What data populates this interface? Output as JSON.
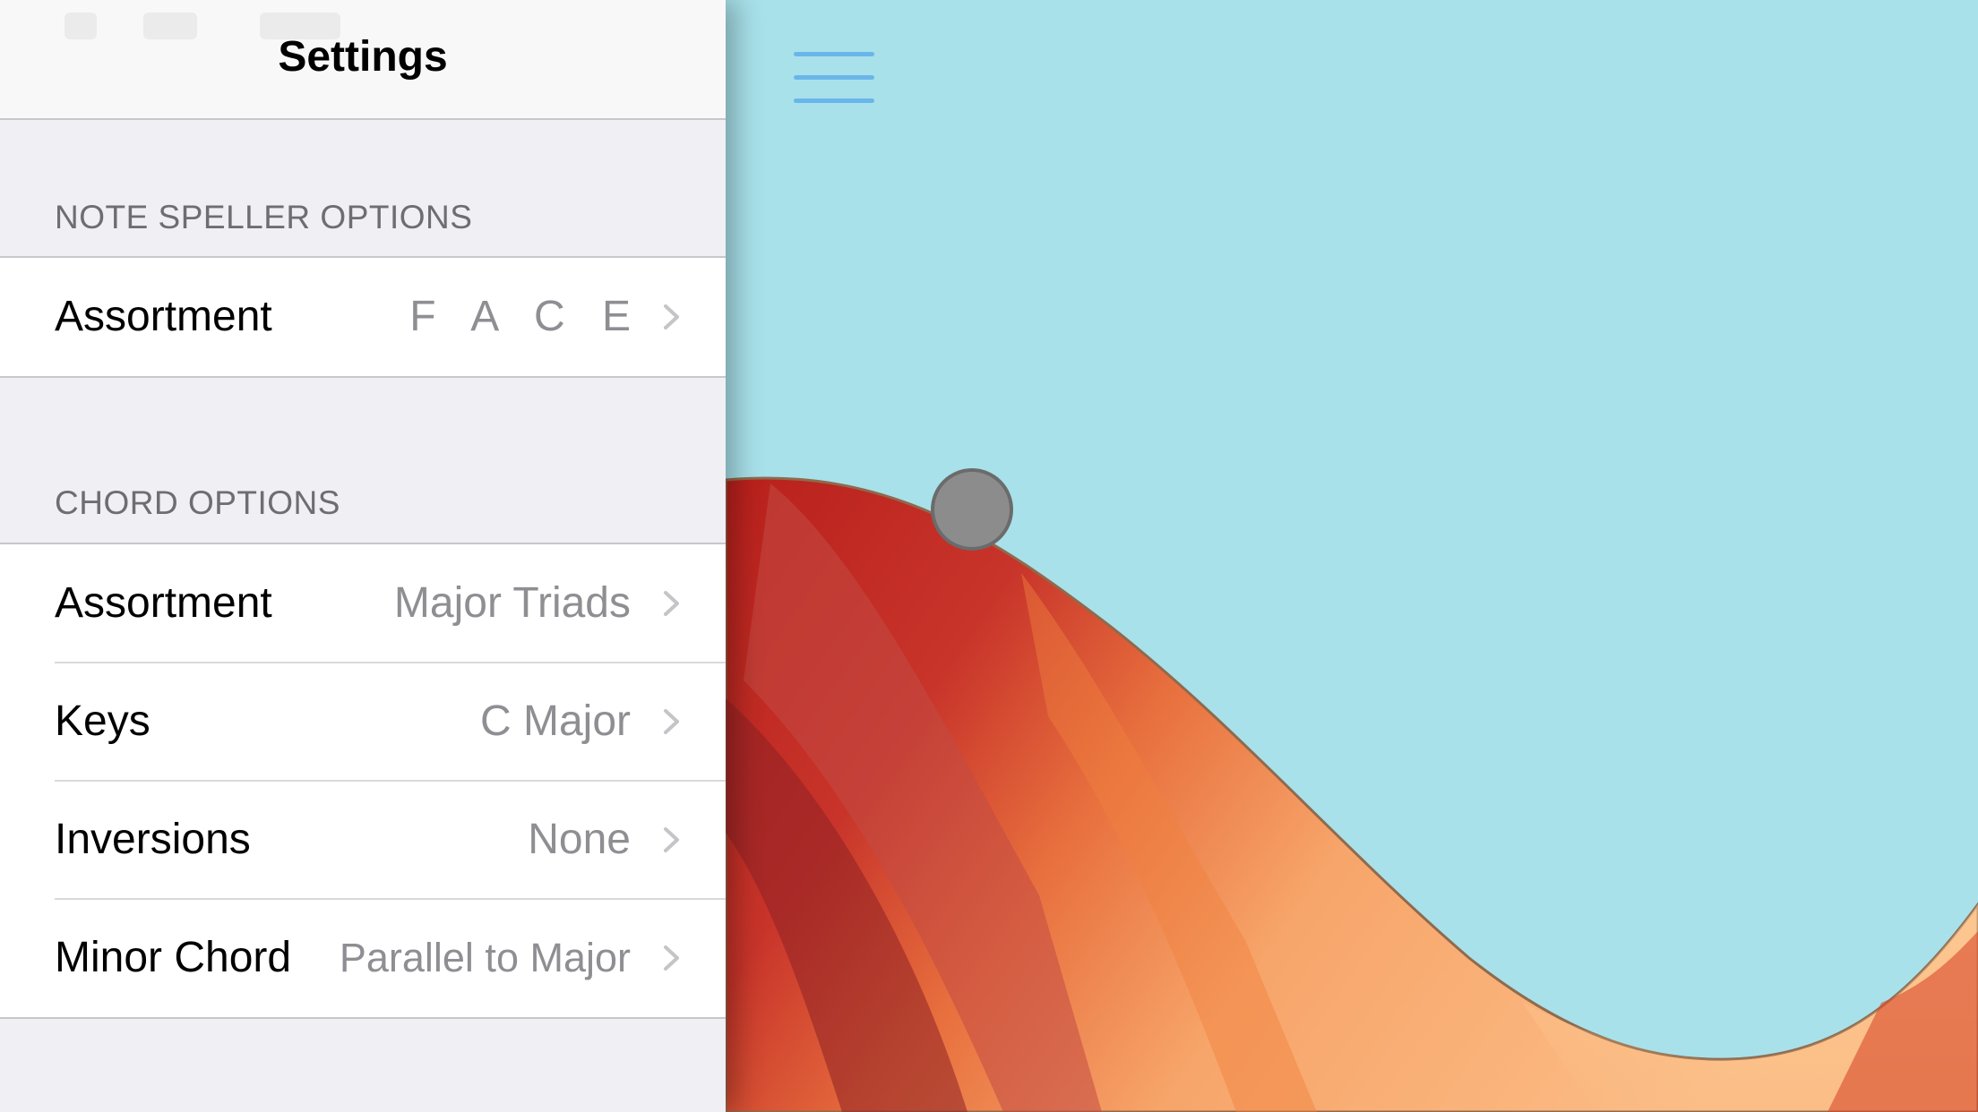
{
  "nav": {
    "title": "Settings"
  },
  "sections": [
    {
      "header": "NOTE SPELLER OPTIONS",
      "rows": [
        {
          "label": "Assortment",
          "value": "F A C E"
        }
      ]
    },
    {
      "header": "CHORD OPTIONS",
      "rows": [
        {
          "label": "Assortment",
          "value": "Major Triads"
        },
        {
          "label": "Keys",
          "value": "C Major"
        },
        {
          "label": "Inversions",
          "value": "None"
        },
        {
          "label": "Minor Chord",
          "value": "Parallel to Major"
        }
      ]
    }
  ],
  "game": {
    "menu_icon": "hamburger-menu-icon",
    "ball_icon": "ball-icon"
  },
  "colors": {
    "sky": "#a8e1ea",
    "hill_light": "#fbb07a",
    "hill_mid": "#e8703e",
    "hill_dark": "#b8201c",
    "menu_accent": "#6ab6ea",
    "ball": "#8c8c8c",
    "panel_background": "#efeff4",
    "secondary_text": "#8e8e93"
  }
}
